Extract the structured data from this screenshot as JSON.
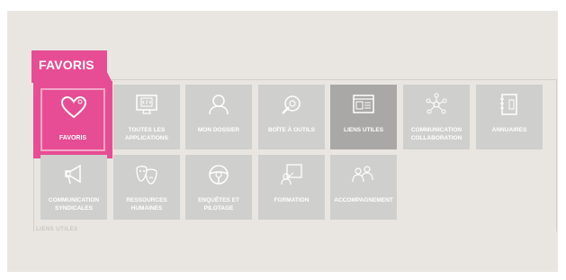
{
  "header": {
    "title": "FAVORIS"
  },
  "tiles": [
    {
      "label": "FAVORIS",
      "icon": "heart-icon",
      "selected": true
    },
    {
      "label": "TOUTES LES\nAPPLICATIONS",
      "icon": "code-monitor-icon"
    },
    {
      "label": "MON DOSSIER",
      "icon": "user-icon"
    },
    {
      "label": "BOÎTE À OUTILS",
      "icon": "tools-icon"
    },
    {
      "label": "LIENS UTILES",
      "icon": "browser-icon",
      "active": true
    },
    {
      "label": "COMMUNICATION\nCOLLABORATION",
      "icon": "network-icon"
    },
    {
      "label": "ANNUAIRES",
      "icon": "address-book-icon"
    },
    {
      "label": "COMMUNICATION\nSYNDICALES",
      "icon": "megaphone-icon"
    },
    {
      "label": "RESSOURCES\nHUMAINES",
      "icon": "masks-icon"
    },
    {
      "label": "ENQUÊTES ET\nPILOTAGE",
      "icon": "steering-wheel-icon"
    },
    {
      "label": "FORMATION",
      "icon": "teacher-board-icon"
    },
    {
      "label": "ACCOMPAGNEMENT",
      "icon": "people-icon"
    }
  ],
  "footer_faded": "LIENS UTILES",
  "colors": {
    "accent": "#e74d94",
    "tile": "#cfcfcd",
    "tile_active": "#a9a8a7",
    "panel": "#e9e6e2"
  }
}
